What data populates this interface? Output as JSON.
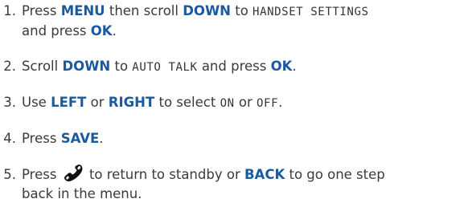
{
  "steps": [
    {
      "number": "1.",
      "press": "Press",
      "menu": "MENU",
      "then_scroll": "then scroll",
      "down": "DOWN",
      "to": "to",
      "lcd_text": "HANDSET SETTINGS",
      "and_press": "and press",
      "ok": "OK",
      "period": "."
    },
    {
      "number": "2.",
      "scroll": "Scroll",
      "down": "DOWN",
      "to": "to",
      "lcd_text": "AUTO TALK",
      "and_press": "and press",
      "ok": "OK",
      "period": "."
    },
    {
      "number": "3.",
      "use": "Use",
      "left": "LEFT",
      "or1": "or",
      "right": "RIGHT",
      "to_select": "to select",
      "lcd_on": "ON",
      "or2": "or",
      "lcd_off": "OFF",
      "period": "."
    },
    {
      "number": "4.",
      "press": "Press",
      "save": "SAVE",
      "period": "."
    },
    {
      "number": "5.",
      "press": "Press",
      "icon": "end-call-icon",
      "to_return": "to return to standby or",
      "back": "BACK",
      "to_go": "to go one step",
      "line2": "back in the menu."
    }
  ],
  "colors": {
    "keyword": "#1a5a9e",
    "text": "#3a3a3a"
  }
}
